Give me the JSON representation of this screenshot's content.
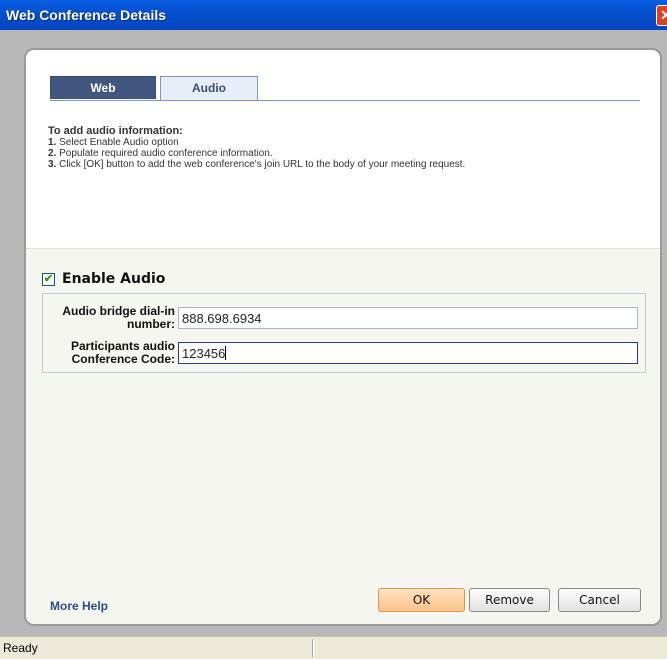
{
  "window": {
    "title": "Web Conference Details",
    "close_glyph": "✕"
  },
  "tabs": [
    {
      "label": "Web",
      "selected": false
    },
    {
      "label": "Audio",
      "selected": true
    }
  ],
  "instructions": {
    "heading": "To add audio information:",
    "steps": [
      {
        "num": "1.",
        "text": "Select Enable Audio option"
      },
      {
        "num": "2.",
        "text": "Populate required audio conference information."
      },
      {
        "num": "3.",
        "text": "Click [OK] button to add the web conference's join URL to the body of your meeting request."
      }
    ]
  },
  "enable_audio": {
    "label": "Enable Audio",
    "checked": true,
    "check_glyph": "✔"
  },
  "fields": {
    "bridge": {
      "label_line1": "Audio bridge dial-in",
      "label_line2": "number:",
      "value": "888.698.6934"
    },
    "code": {
      "label_line1": "Participants audio",
      "label_line2": "Conference Code:",
      "value": "123456"
    }
  },
  "footer": {
    "more_help": "More Help",
    "ok": "OK",
    "remove": "Remove",
    "cancel": "Cancel"
  },
  "statusbar": {
    "text": "Ready"
  }
}
